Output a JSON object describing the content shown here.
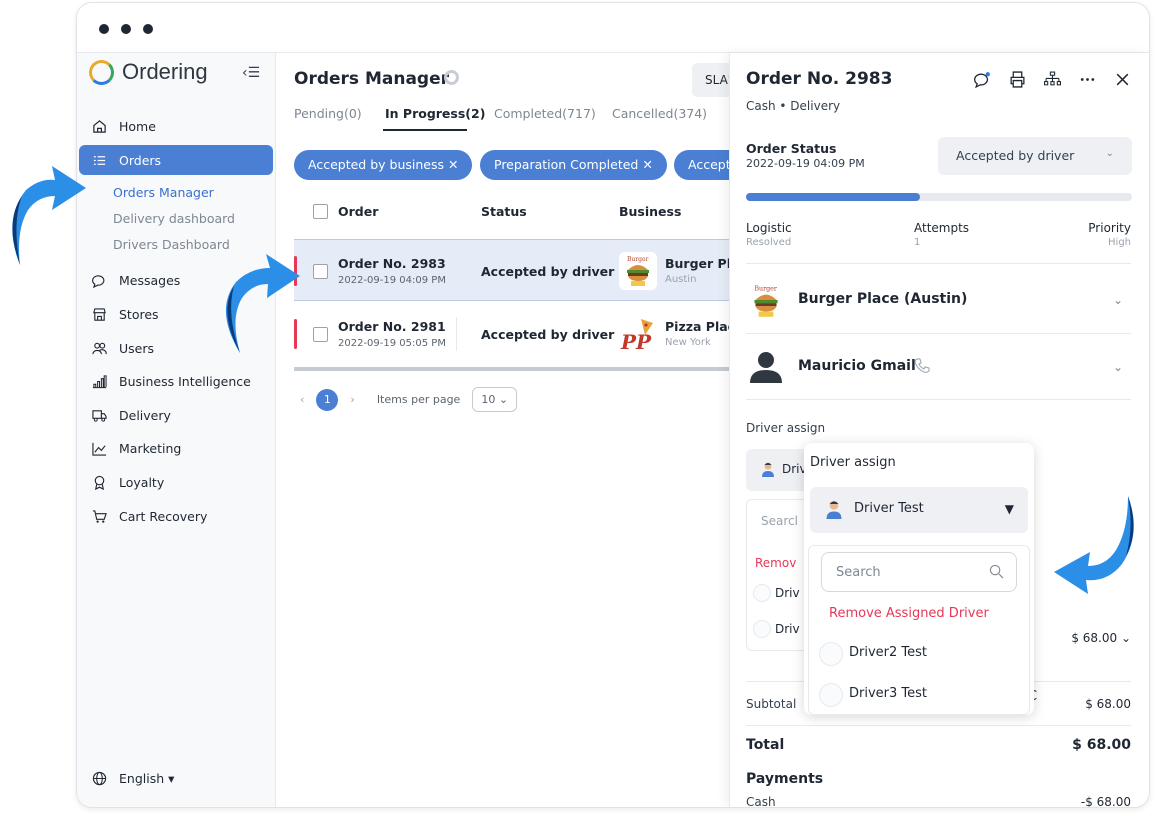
{
  "sidebar": {
    "brand": "Ordering",
    "collapse_icon": "‹☰",
    "nav": [
      {
        "label": "Home",
        "icon": "home-icon"
      },
      {
        "label": "Orders",
        "icon": "list-icon"
      },
      {
        "label": "Messages",
        "icon": "chat-icon"
      },
      {
        "label": "Stores",
        "icon": "store-icon"
      },
      {
        "label": "Users",
        "icon": "users-icon"
      },
      {
        "label": "Business Intelligence",
        "icon": "bar-chart-icon"
      },
      {
        "label": "Delivery",
        "icon": "truck-icon"
      },
      {
        "label": "Marketing",
        "icon": "trend-icon"
      },
      {
        "label": "Loyalty",
        "icon": "award-icon"
      },
      {
        "label": "Cart Recovery",
        "icon": "cart-icon"
      }
    ],
    "sub": [
      "Orders Manager",
      "Delivery dashboard",
      "Drivers Dashboard"
    ],
    "language": "English ▾"
  },
  "main": {
    "title": "Orders Manager",
    "sla": "SLA's",
    "tabs": [
      "Pending(0)",
      "In Progress(2)",
      "Completed(717)",
      "Cancelled(374)"
    ],
    "chips": [
      "Accepted by business ✕",
      "Preparation Completed ✕",
      "Accepte"
    ],
    "columns": [
      "Order",
      "Status",
      "Business"
    ],
    "rows": [
      {
        "num": "Order No. 2983",
        "date": "2022-09-19 04:09 PM",
        "status": "Accepted by driver",
        "business": "Burger Plac",
        "city": "Austin"
      },
      {
        "num": "Order No. 2981",
        "date": "2022-09-19 05:05 PM",
        "status": "Accepted by driver",
        "business": "Pizza Place",
        "city": "New York"
      }
    ],
    "pager": {
      "prev": "‹",
      "page": "1",
      "next": "›",
      "items_label": "Items per page",
      "items_value": "10 ⌄"
    }
  },
  "panel": {
    "title": "Order No. 2983",
    "sub": "Cash • Delivery",
    "order_status_label": "Order Status",
    "order_status_date": "2022-09-19 04:09 PM",
    "status_value": "Accepted by driver",
    "progress": 0.45,
    "meta": [
      {
        "label": "Logistic",
        "value": "Resolved"
      },
      {
        "label": "Attempts",
        "value": "1"
      },
      {
        "label": "Priority",
        "value": "High"
      }
    ],
    "business": "Burger Place (Austin)",
    "customer": "Mauricio Gmail",
    "driver_assign": "Driver assign",
    "bg_driver": "Driv",
    "bg_search": "Searcl",
    "bg_remove": "Remov",
    "bg_opt1": "Driv",
    "bg_opt2": "Driv",
    "line_amount": "$ 68.00 ⌄",
    "subtotal_label": "Subtotal",
    "subtotal_value": "$ 68.00",
    "total_label": "Total",
    "total_value": "$ 68.00",
    "payments_label": "Payments",
    "payment_method": "Cash",
    "payment_value": "-$ 68.00",
    "extra_char": "C"
  },
  "popover": {
    "title": "Driver assign",
    "selected": "Driver Test",
    "caret": "▼",
    "search_placeholder": "Search",
    "remove": "Remove Assigned Driver",
    "options": [
      "Driver2 Test",
      "Driver3 Test"
    ]
  },
  "colors": {
    "accent": "#4a7fd4",
    "danger": "#e63757",
    "arrow": "#2b8fe8"
  }
}
